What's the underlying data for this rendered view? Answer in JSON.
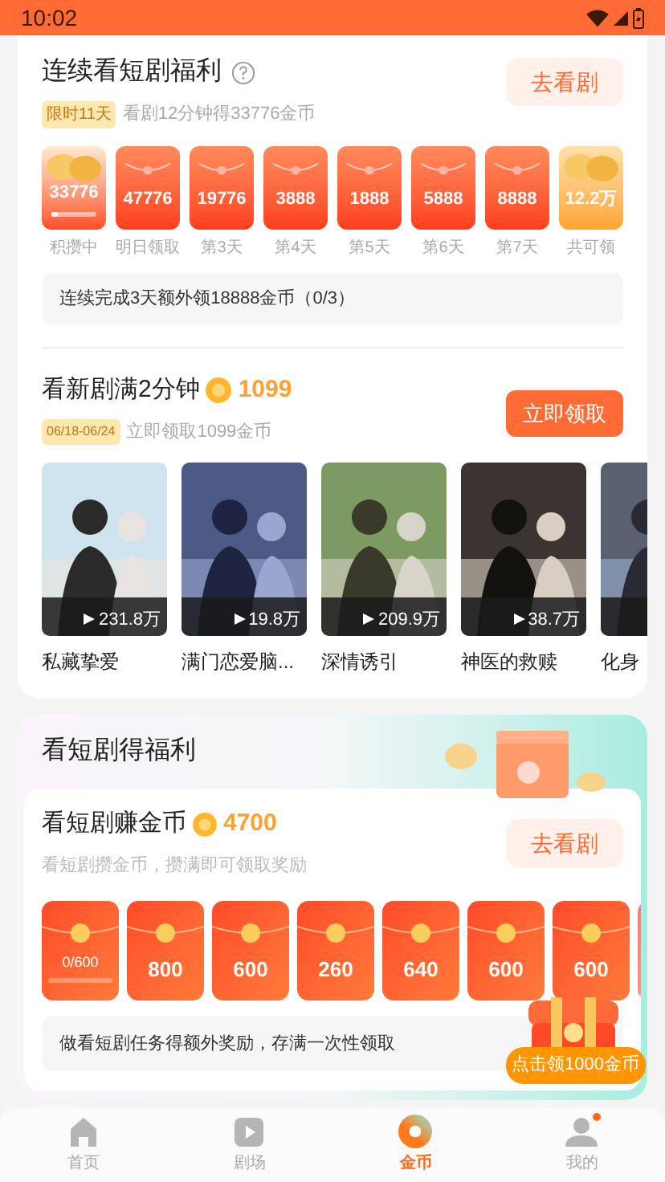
{
  "status_bar": {
    "time": "10:02"
  },
  "streak": {
    "title": "连续看短剧福利",
    "tag": "限时11天",
    "subtitle": "看剧12分钟得33776金币",
    "button": "去看剧",
    "days": [
      {
        "kind": "coin",
        "amount": "33776",
        "label": "积攒中",
        "level": 0.15
      },
      {
        "kind": "envelope",
        "amount": "47776",
        "label": "明日领取"
      },
      {
        "kind": "envelope",
        "amount": "19776",
        "label": "第3天"
      },
      {
        "kind": "envelope",
        "amount": "3888",
        "label": "第4天"
      },
      {
        "kind": "envelope",
        "amount": "1888",
        "label": "第5天"
      },
      {
        "kind": "envelope",
        "amount": "5888",
        "label": "第6天"
      },
      {
        "kind": "envelope",
        "amount": "8888",
        "label": "第7天"
      },
      {
        "kind": "total",
        "amount": "12.2万",
        "label": "共可领"
      }
    ],
    "notice": "连续完成3天额外领18888金币（0/3）"
  },
  "new_drama": {
    "title": "看新剧满2分钟",
    "coins": "1099",
    "tag": "06/18-06/24",
    "subtitle": "立即领取1099金币",
    "button": "立即领取",
    "posters": [
      {
        "title": "私藏挚爱",
        "views": "231.8万"
      },
      {
        "title": "满门恋爱脑...",
        "views": "19.8万"
      },
      {
        "title": "深情诱引",
        "views": "209.9万"
      },
      {
        "title": "神医的救赎",
        "views": "38.7万"
      },
      {
        "title": "化身"
      }
    ]
  },
  "welfare": {
    "title": "看短剧得福利",
    "task_title": "看短剧赚金币",
    "coins": "4700",
    "subtitle": "看短剧攒金币，攒满即可领取奖励",
    "button": "去看剧",
    "envelopes": [
      {
        "kind": "progress",
        "amount": "0/600",
        "level": 0
      },
      {
        "kind": "plain",
        "amount": "800"
      },
      {
        "kind": "plain",
        "amount": "600"
      },
      {
        "kind": "plain",
        "amount": "260"
      },
      {
        "kind": "plain",
        "amount": "640"
      },
      {
        "kind": "plain",
        "amount": "600"
      },
      {
        "kind": "plain",
        "amount": "600"
      }
    ],
    "notice": "做看短剧任务得额外奖励，存满一次性领取",
    "chest_button": "点击领1000金币"
  },
  "tab_bar": [
    {
      "label": "首页",
      "selected": false,
      "dot": false
    },
    {
      "label": "剧场",
      "selected": false,
      "dot": false
    },
    {
      "label": "金币",
      "selected": true,
      "dot": false
    },
    {
      "label": "我的",
      "selected": false,
      "dot": true
    }
  ]
}
